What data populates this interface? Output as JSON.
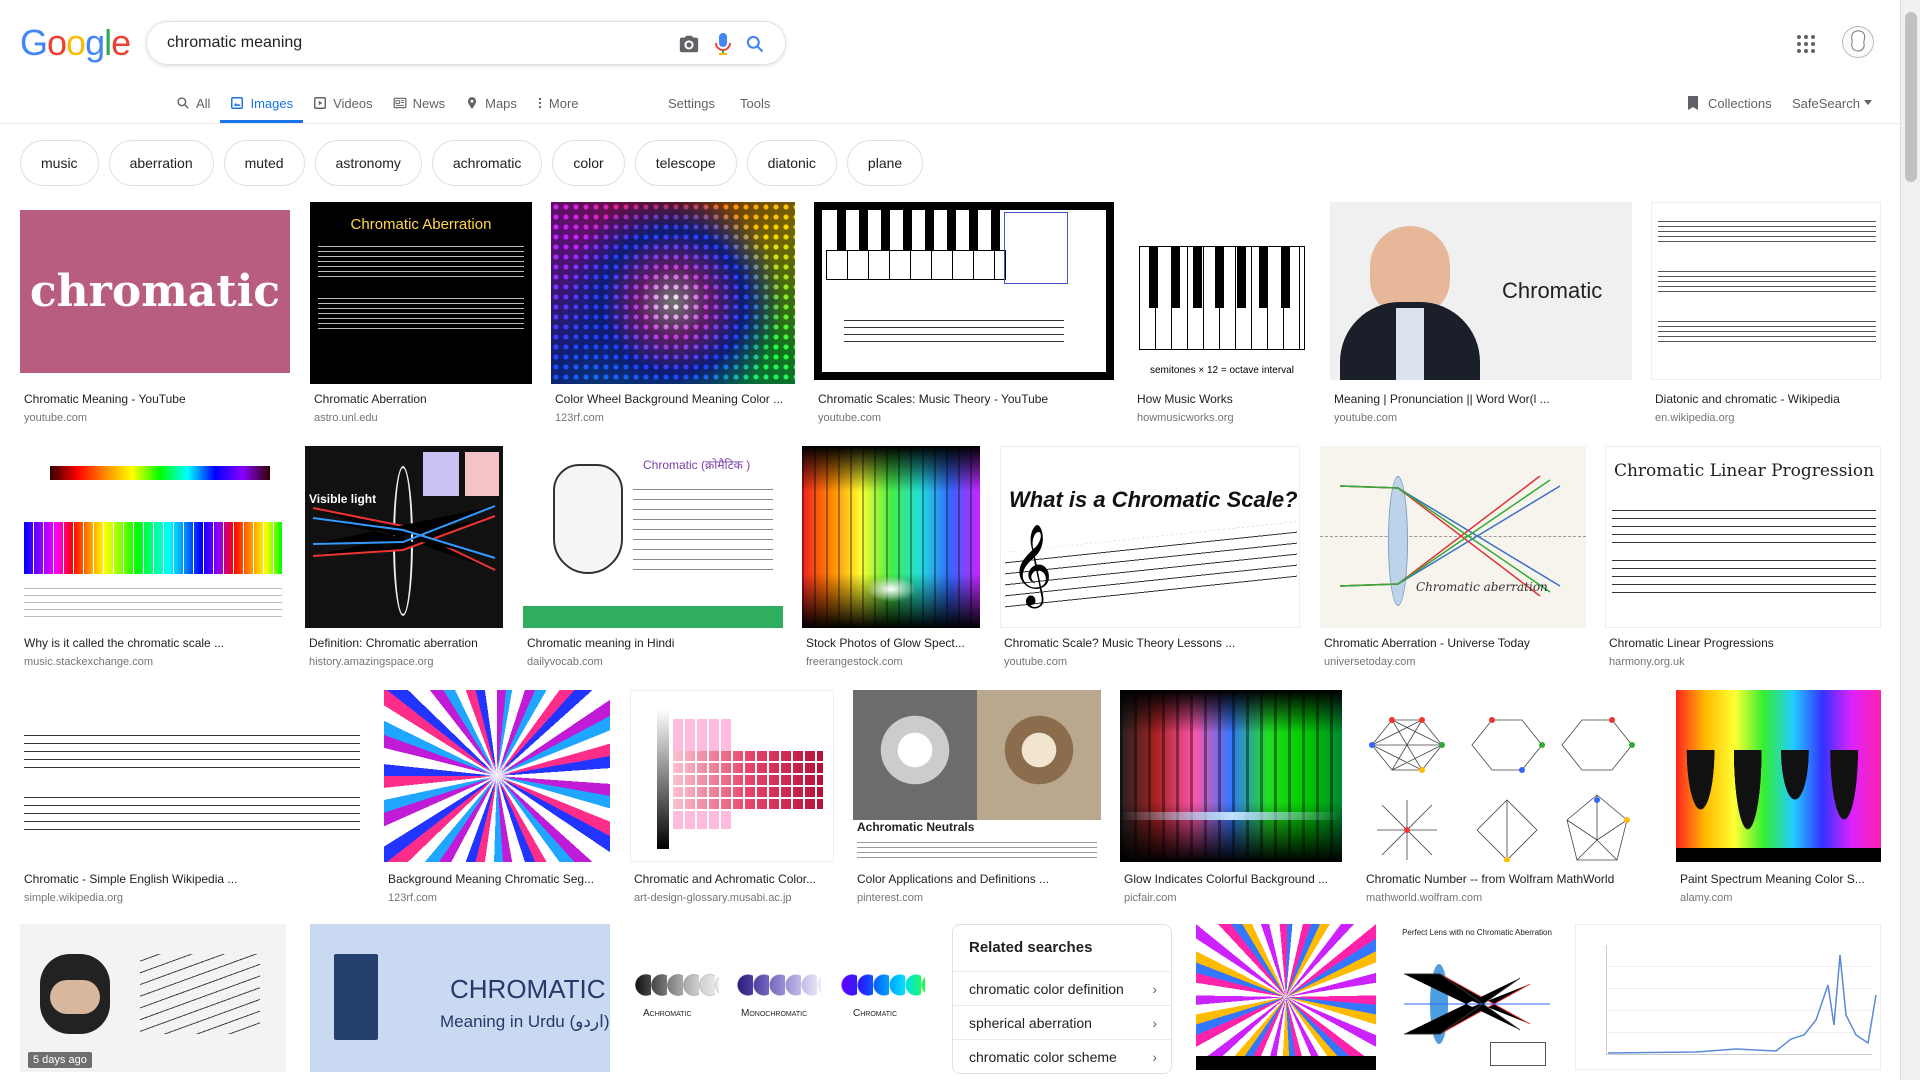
{
  "search": {
    "query": "chromatic meaning"
  },
  "logo": {
    "letters": [
      "G",
      "o",
      "o",
      "g",
      "l",
      "e"
    ],
    "colors": [
      "#4285f4",
      "#ea4335",
      "#fbbc05",
      "#4285f4",
      "#34a853",
      "#ea4335"
    ]
  },
  "tabs": [
    {
      "label": "All",
      "icon": "search-icon"
    },
    {
      "label": "Images",
      "icon": "image-icon",
      "active": true
    },
    {
      "label": "Videos",
      "icon": "video-icon"
    },
    {
      "label": "News",
      "icon": "news-icon"
    },
    {
      "label": "Maps",
      "icon": "map-pin-icon"
    },
    {
      "label": "More",
      "icon": "more-vert-icon"
    }
  ],
  "tools": {
    "settings": "Settings",
    "tools": "Tools",
    "collections": "Collections",
    "safesearch": "SafeSearch"
  },
  "chips": [
    "music",
    "aberration",
    "muted",
    "astronomy",
    "achromatic",
    "color",
    "telescope",
    "diatonic",
    "plane"
  ],
  "results": [
    {
      "caption": "Chromatic Meaning - YouTube",
      "source": "youtube.com",
      "thumb_text": "chromatic"
    },
    {
      "caption": "Chromatic Aberration",
      "source": "astro.unl.edu",
      "thumb_text": "Chromatic Aberration"
    },
    {
      "caption": "Color Wheel Background Meaning Color ...",
      "source": "123rf.com"
    },
    {
      "caption": "Chromatic Scales: Music Theory - YouTube",
      "source": "youtube.com"
    },
    {
      "caption": "How Music Works",
      "source": "howmusicworks.org",
      "thumb_text": "semitones × 12 = octave interval"
    },
    {
      "caption": "Meaning | Pronunciation || Word Wor(l ...",
      "source": "youtube.com",
      "thumb_text": "Chromatic"
    },
    {
      "caption": "Diatonic and chromatic - Wikipedia",
      "source": "en.wikipedia.org"
    },
    {
      "caption": "Why is it called the chromatic scale ...",
      "source": "music.stackexchange.com"
    },
    {
      "caption": "Definition: Chromatic aberration",
      "source": "history.amazingspace.org",
      "thumb_text": "Visible light"
    },
    {
      "caption": "Chromatic meaning in Hindi",
      "source": "dailyvocab.com",
      "thumb_text": "Chromatic (क्रोमैटिक )"
    },
    {
      "caption": "Stock Photos of Glow Spect...",
      "source": "freerangestock.com"
    },
    {
      "caption": "Chromatic Scale? Music Theory Lessons ...",
      "source": "youtube.com",
      "thumb_text": "What is a Chromatic Scale?"
    },
    {
      "caption": "Chromatic Aberration - Universe Today",
      "source": "universetoday.com",
      "thumb_text": "Chromatic aberration"
    },
    {
      "caption": "Chromatic Linear Progressions",
      "source": "harmony.org.uk",
      "thumb_text": "Chromatic Linear Progression"
    },
    {
      "caption": "Chromatic - Simple English Wikipedia ...",
      "source": "simple.wikipedia.org"
    },
    {
      "caption": "Background Meaning Chromatic Seg...",
      "source": "123rf.com"
    },
    {
      "caption": "Chromatic and Achromatic Color...",
      "source": "art-design-glossary.musabi.ac.jp"
    },
    {
      "caption": "Color Applications and Definitions ...",
      "source": "pinterest.com",
      "thumb_text": "Achromatic Neutrals"
    },
    {
      "caption": "Glow Indicates Colorful Background ...",
      "source": "picfair.com"
    },
    {
      "caption": "Chromatic Number -- from Wolfram MathWorld",
      "source": "mathworld.wolfram.com"
    },
    {
      "caption": "Paint Spectrum Meaning Color S...",
      "source": "alamy.com"
    },
    {
      "timestamp": "5 days ago"
    },
    {
      "thumb_text": "CHROMATIC",
      "thumb_sub": "Meaning in Urdu (اردو)"
    },
    {
      "thumb_labels": [
        "Achromatic",
        "Monochromatic",
        "Chromatic"
      ]
    },
    {},
    {
      "thumb_text": "Perfect Lens with no Chromatic Aberration"
    },
    {}
  ],
  "related": {
    "title": "Related searches",
    "items": [
      "chromatic color definition",
      "spherical aberration",
      "chromatic color scheme"
    ]
  }
}
